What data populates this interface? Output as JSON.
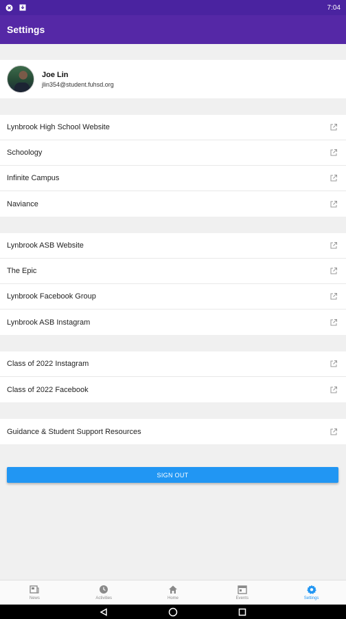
{
  "status_bar": {
    "time": "7:04",
    "icons": [
      "app-notification-icon",
      "download-icon"
    ]
  },
  "app_bar": {
    "title": "Settings"
  },
  "profile": {
    "name": "Joe Lin",
    "email": "jlin354@student.fuhsd.org"
  },
  "groups": [
    {
      "items": [
        {
          "label": "Lynbrook High School Website"
        },
        {
          "label": "Schoology"
        },
        {
          "label": "Infinite Campus"
        },
        {
          "label": "Naviance"
        }
      ]
    },
    {
      "items": [
        {
          "label": "Lynbrook ASB Website"
        },
        {
          "label": "The Epic"
        },
        {
          "label": "Lynbrook Facebook Group"
        },
        {
          "label": "Lynbrook ASB Instagram"
        }
      ]
    },
    {
      "items": [
        {
          "label": "Class of 2022 Instagram"
        },
        {
          "label": "Class of 2022 Facebook"
        }
      ]
    },
    {
      "items": [
        {
          "label": "Guidance & Student Support Resources"
        }
      ]
    }
  ],
  "sign_out": {
    "label": "SIGN OUT"
  },
  "bottom_nav": {
    "items": [
      {
        "label": "News",
        "icon": "news-icon"
      },
      {
        "label": "Activities",
        "icon": "clock-icon"
      },
      {
        "label": "Home",
        "icon": "home-icon"
      },
      {
        "label": "Events",
        "icon": "calendar-icon"
      },
      {
        "label": "Settings",
        "icon": "gear-icon"
      }
    ],
    "active_index": 4
  },
  "colors": {
    "app_bar": "#5528a6",
    "status_bar": "#4a23a0",
    "accent": "#2196f3"
  }
}
